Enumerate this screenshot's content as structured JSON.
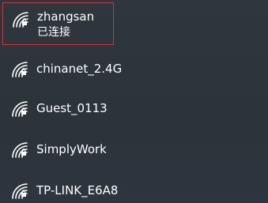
{
  "networks": [
    {
      "ssid": "zhangsan",
      "status": "已连接",
      "icon": "wifi-secured-icon",
      "selected": true
    },
    {
      "ssid": "chinanet_2.4G",
      "icon": "wifi-secured-icon"
    },
    {
      "ssid": "Guest_0113",
      "icon": "wifi-secured-icon"
    },
    {
      "ssid": "SimplyWork",
      "icon": "wifi-secured-icon"
    },
    {
      "ssid": "TP-LINK_E6A8",
      "icon": "wifi-secured-icon"
    }
  ],
  "colors": {
    "background": "#2d343b",
    "text": "#ffffff",
    "selection_border": "#d8303a"
  }
}
